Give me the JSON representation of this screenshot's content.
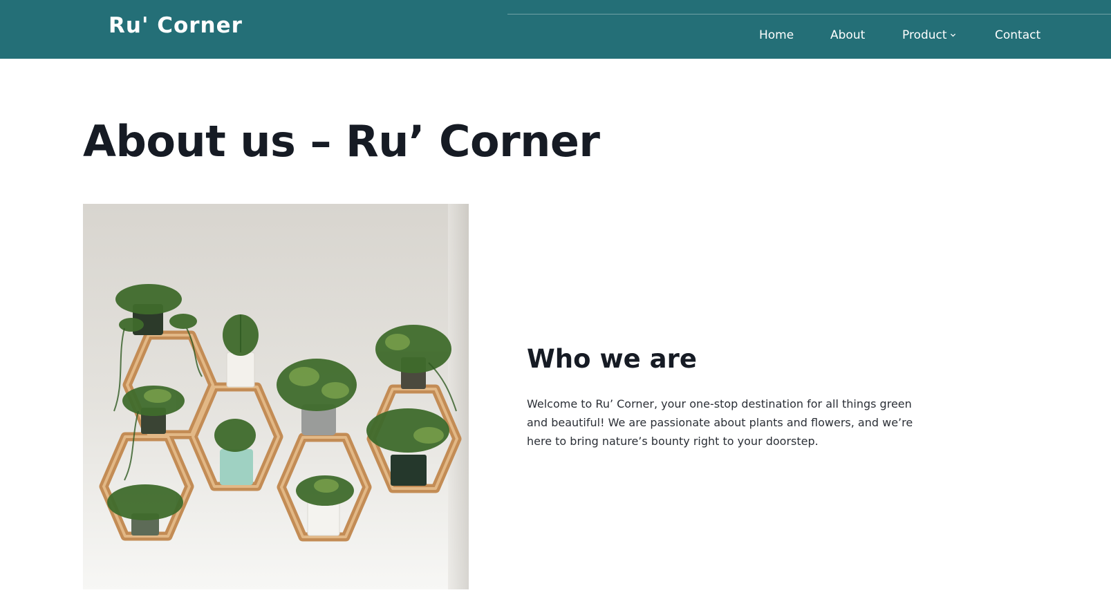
{
  "site": {
    "logo": "Ru' Corner"
  },
  "nav": {
    "items": [
      {
        "label": "Home"
      },
      {
        "label": "About"
      },
      {
        "label": "Product"
      },
      {
        "label": "Contact"
      }
    ]
  },
  "page": {
    "title": "About us – Ru’ Corner"
  },
  "section": {
    "title": "Who we are",
    "text": "Welcome to Ru’ Corner, your one-stop destination for all things green and beautiful! We are passionate about plants and flowers, and we’re here to bring nature’s bounty right to your doorstep."
  },
  "colors": {
    "header_bg": "#246f77",
    "text_dark": "#161b24",
    "wood": "#c8935b"
  },
  "icons": {
    "product_dropdown": "chevron-down-icon"
  }
}
